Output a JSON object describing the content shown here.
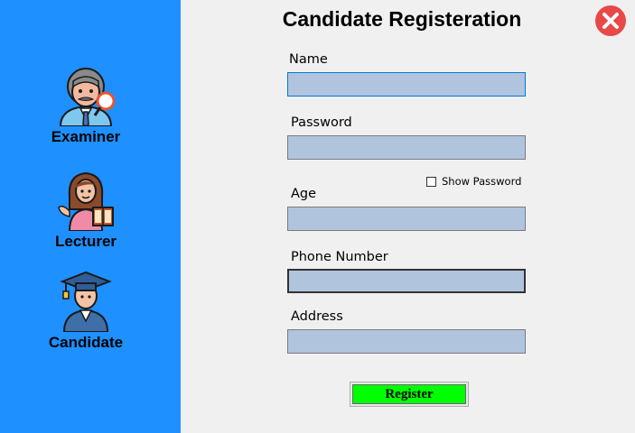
{
  "sidebar": {
    "items": [
      {
        "label": "Examiner",
        "icon": "examiner-icon"
      },
      {
        "label": "Lecturer",
        "icon": "lecturer-icon"
      },
      {
        "label": "Candidate",
        "icon": "candidate-icon"
      }
    ]
  },
  "form": {
    "title": "Candidate Registeration",
    "name_label": "Name",
    "name_value": "",
    "password_label": "Password",
    "password_value": "",
    "show_password_label": "Show Password",
    "show_password_checked": false,
    "age_label": "Age",
    "age_value": "",
    "phone_label": "Phone Number",
    "phone_value": "",
    "address_label": "Address",
    "address_value": "",
    "register_label": "Register"
  },
  "colors": {
    "sidebar": "#1e90ff",
    "field": "#b0c4de",
    "register_button": "#00ff00",
    "close_button": "#e84848"
  },
  "close_icon": "close-icon"
}
